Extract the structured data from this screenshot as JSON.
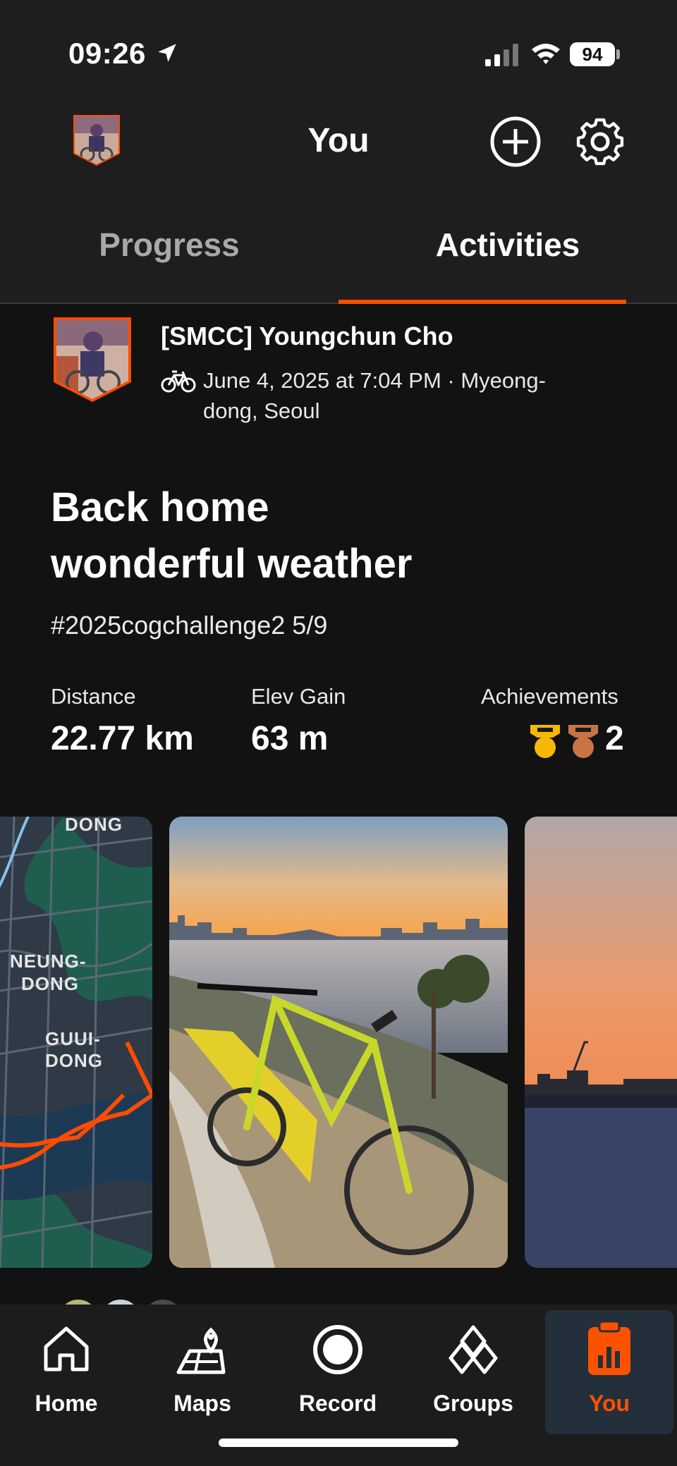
{
  "status_bar": {
    "time": "09:26",
    "battery": "94"
  },
  "header": {
    "title": "You"
  },
  "tabs": [
    {
      "label": "Progress"
    },
    {
      "label": "Activities"
    }
  ],
  "activity": {
    "athlete": "[SMCC] Youngchun Cho",
    "meta": "June 4, 2025 at 7:04 PM · Myeong-dong, Seoul",
    "title_line1": "Back home",
    "title_line2": "wonderful weather",
    "tags": "#2025cogchallenge2 5/9",
    "stats": {
      "distance_label": "Distance",
      "distance_value": "22.77 km",
      "elev_label": "Elev Gain",
      "elev_value": "63 m",
      "achievements_label": "Achievements",
      "achievements_value": "2"
    },
    "map_labels": [
      "DONG",
      "NEUNG-",
      "DONG",
      "GUUI-DONG"
    ]
  },
  "nav": [
    {
      "label": "Home",
      "icon": "home-icon"
    },
    {
      "label": "Maps",
      "icon": "maps-icon"
    },
    {
      "label": "Record",
      "icon": "record-icon"
    },
    {
      "label": "Groups",
      "icon": "groups-icon"
    },
    {
      "label": "You",
      "icon": "you-icon",
      "active": true
    }
  ],
  "colors": {
    "accent": "#fc4c02",
    "background": "#121212",
    "header": "#1e1e1e",
    "nav_active_bg": "#23303b"
  }
}
